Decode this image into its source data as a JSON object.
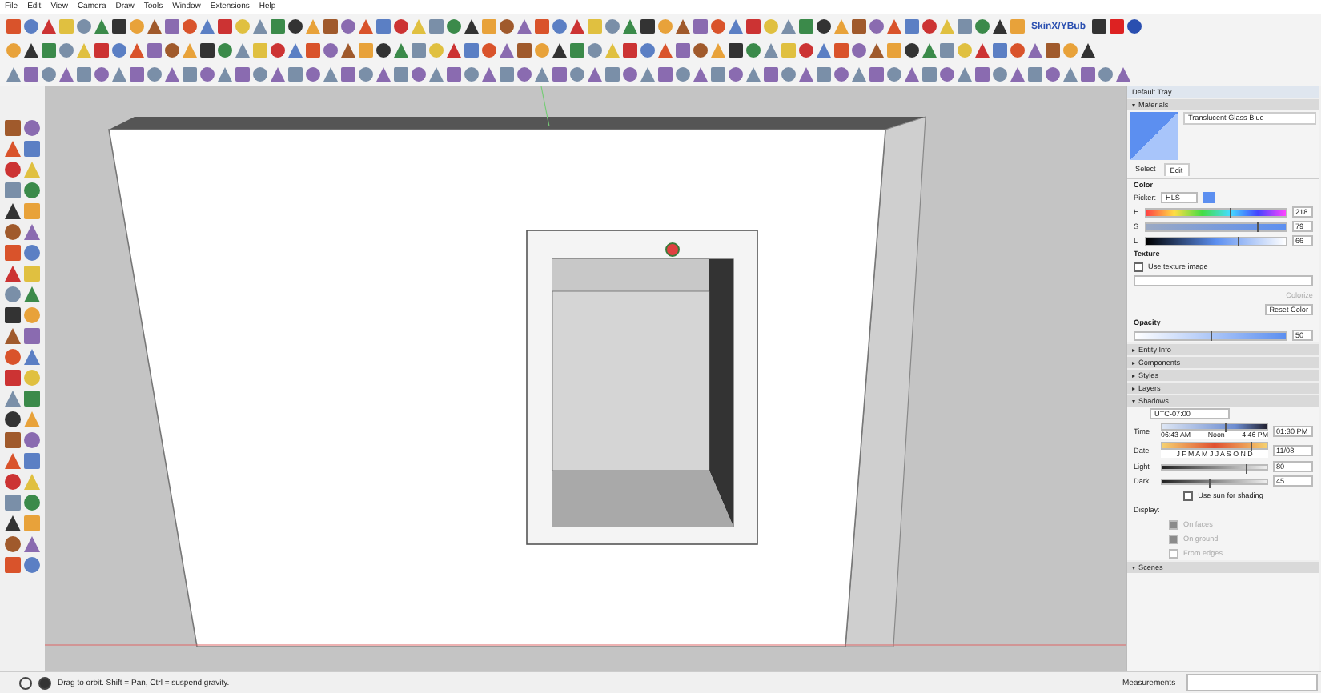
{
  "menu_bar": {
    "items": [
      "File",
      "Edit",
      "View",
      "Camera",
      "Draw",
      "Tools",
      "Window",
      "Extensions",
      "Help"
    ]
  },
  "toolbar_logo": {
    "text": "SkinX/YBub"
  },
  "tray": {
    "title": "Default Tray",
    "materials": {
      "title": "Materials",
      "expanded": true,
      "material_name": "Translucent Glass Blue",
      "tabs": [
        {
          "label": "Select",
          "selected": false
        },
        {
          "label": "Edit",
          "selected": true
        }
      ],
      "color_heading": "Color",
      "picker_label": "Picker:",
      "picker_value": "HLS",
      "channels": [
        {
          "name": "H",
          "level": 0.6,
          "value": "218"
        },
        {
          "name": "S",
          "level": 0.79,
          "value": "79"
        },
        {
          "name": "L",
          "level": 0.66,
          "value": "66"
        }
      ],
      "texture_heading": "Texture",
      "use_texture": {
        "label": "Use texture image",
        "checked": false
      },
      "colorize": {
        "label": "Colorize",
        "disabled": true
      },
      "reset_color": "Reset Color",
      "opacity_heading": "Opacity",
      "opacity": {
        "level": 0.5,
        "value": "50"
      }
    },
    "sections": [
      {
        "title": "Entity Info",
        "expanded": false
      },
      {
        "title": "Components",
        "expanded": false
      },
      {
        "title": "Styles",
        "expanded": false
      },
      {
        "title": "Layers",
        "expanded": false
      },
      {
        "title": "Shadows",
        "expanded": true
      }
    ],
    "shadows": {
      "timezone": "UTC-07:00",
      "time": {
        "label": "Time",
        "ticks": [
          "06:43 AM",
          "Noon",
          "4:46 PM"
        ],
        "level": 0.6,
        "value": "01:30 PM"
      },
      "date": {
        "label": "Date",
        "ticks": [
          "J F M A M J J A S O N D"
        ],
        "level": 0.85,
        "value": "11/08"
      },
      "light": {
        "label": "Light",
        "level": 0.8,
        "value": "80"
      },
      "dark": {
        "label": "Dark",
        "level": 0.45,
        "value": "45"
      },
      "use_sun": {
        "label": "Use sun for shading",
        "checked": false
      },
      "display_label": "Display:",
      "display_options": [
        {
          "label": "On faces",
          "checked": true,
          "disabled": true
        },
        {
          "label": "On ground",
          "checked": true,
          "disabled": true
        },
        {
          "label": "From edges",
          "checked": false,
          "disabled": true
        }
      ]
    },
    "scenes": {
      "title": "Scenes",
      "expanded": true
    }
  },
  "status_bar": {
    "hint": "Drag to orbit. Shift = Pan, Ctrl = suspend gravity.",
    "measurements_label": "Measurements"
  }
}
